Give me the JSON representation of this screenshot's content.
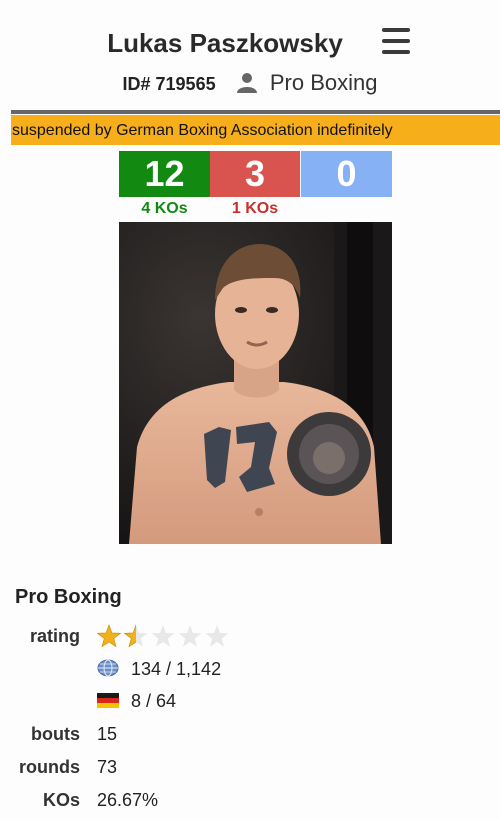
{
  "header": {
    "name": "Lukas Paszkowsky",
    "id_label": "ID# 719565",
    "category": "Pro Boxing"
  },
  "status_banner": "suspended by German Boxing Association indefinitely",
  "record": {
    "wins": "12",
    "losses": "3",
    "draws": "0",
    "win_kos": "4 KOs",
    "loss_kos": "1 KOs"
  },
  "colors": {
    "win": "#128a12",
    "loss": "#d9534f",
    "draw": "#86b1f5",
    "banner": "#f7ae1b"
  },
  "profile": {
    "section_title": "Pro Boxing",
    "rating_label": "rating",
    "rating_stars": 1.5,
    "rating_max": 5,
    "world_rank": "134 / 1,142",
    "country_rank": "8 / 64",
    "bouts_label": "bouts",
    "bouts": "15",
    "rounds_label": "rounds",
    "rounds": "73",
    "kos_label": "KOs",
    "kos": "26.67%"
  },
  "icons": {
    "menu": "hamburger-menu-icon",
    "person": "person-icon",
    "world": "globe-icon",
    "country": "germany-flag-icon"
  }
}
